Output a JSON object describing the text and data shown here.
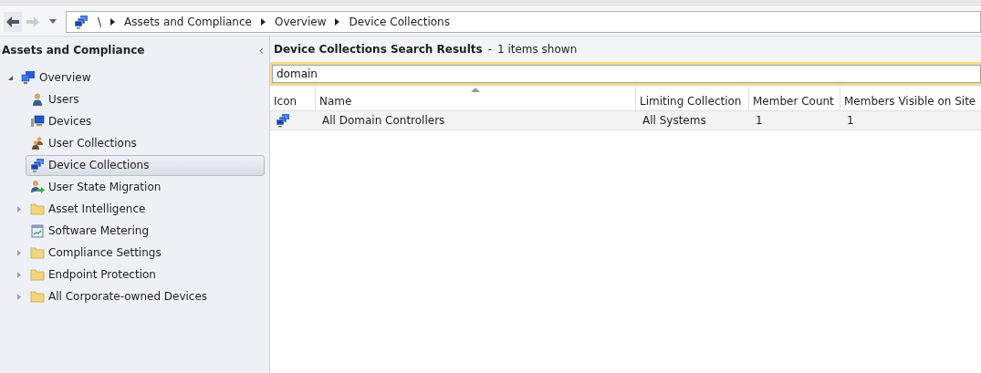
{
  "nav": {
    "back_enabled": true,
    "forward_enabled": false,
    "breadcrumb": [
      "\\",
      "Assets and Compliance",
      "Overview",
      "Device Collections"
    ]
  },
  "sidebar": {
    "title": "Assets and Compliance",
    "collapse_glyph": "‹",
    "tree": [
      {
        "label": "Overview",
        "kind": "overview",
        "expanded": true,
        "selected": false,
        "children": [
          {
            "label": "Users",
            "kind": "user",
            "selected": false
          },
          {
            "label": "Devices",
            "kind": "device",
            "selected": false
          },
          {
            "label": "User Collections",
            "kind": "user-collection",
            "selected": false
          },
          {
            "label": "Device Collections",
            "kind": "device-collection",
            "selected": true
          },
          {
            "label": "User State Migration",
            "kind": "migration",
            "selected": false
          },
          {
            "label": "Asset Intelligence",
            "kind": "folder",
            "expanded": false,
            "selected": false
          },
          {
            "label": "Software Metering",
            "kind": "metering",
            "selected": false
          },
          {
            "label": "Compliance Settings",
            "kind": "folder",
            "expanded": false,
            "selected": false
          },
          {
            "label": "Endpoint Protection",
            "kind": "folder",
            "expanded": false,
            "selected": false
          },
          {
            "label": "All Corporate-owned Devices",
            "kind": "folder",
            "expanded": false,
            "selected": false
          }
        ]
      }
    ]
  },
  "results": {
    "title": "Device Collections Search Results",
    "separator": "-",
    "summary": "1 items shown",
    "search": {
      "value": "domain"
    },
    "table": {
      "columns": [
        {
          "label": "Icon",
          "sorted": false
        },
        {
          "label": "Name",
          "sorted": true
        },
        {
          "label": "Limiting Collection",
          "sorted": false
        },
        {
          "label": "Member Count",
          "sorted": false
        },
        {
          "label": "Members Visible on Site",
          "sorted": false
        }
      ],
      "rows": [
        {
          "cells": [
            "",
            "All Domain Controllers",
            "All Systems",
            "1",
            "1"
          ],
          "selected": false
        }
      ]
    }
  }
}
